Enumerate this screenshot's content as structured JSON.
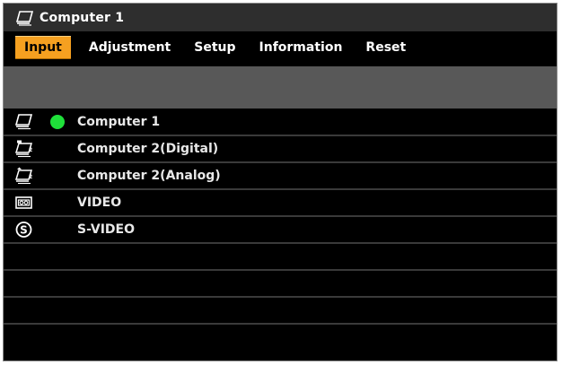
{
  "title": {
    "text": "Computer 1",
    "icon": "computer-icon"
  },
  "tabs": [
    {
      "label": "Input",
      "active": true
    },
    {
      "label": "Adjustment",
      "active": false
    },
    {
      "label": "Setup",
      "active": false
    },
    {
      "label": "Information",
      "active": false
    },
    {
      "label": "Reset",
      "active": false
    }
  ],
  "sources": [
    {
      "label": "Computer 1",
      "icon": "computer-1-icon",
      "selected": true
    },
    {
      "label": "Computer 2(Digital)",
      "icon": "computer-2-digital-icon",
      "selected": false
    },
    {
      "label": "Computer 2(Analog)",
      "icon": "computer-2-analog-icon",
      "selected": false
    },
    {
      "label": "VIDEO",
      "icon": "video-icon",
      "selected": false
    },
    {
      "label": "S-VIDEO",
      "icon": "s-video-icon",
      "selected": false
    }
  ],
  "colors": {
    "accent": "#f5a020",
    "selected_indicator": "#1fe03a",
    "background": "#000000"
  }
}
